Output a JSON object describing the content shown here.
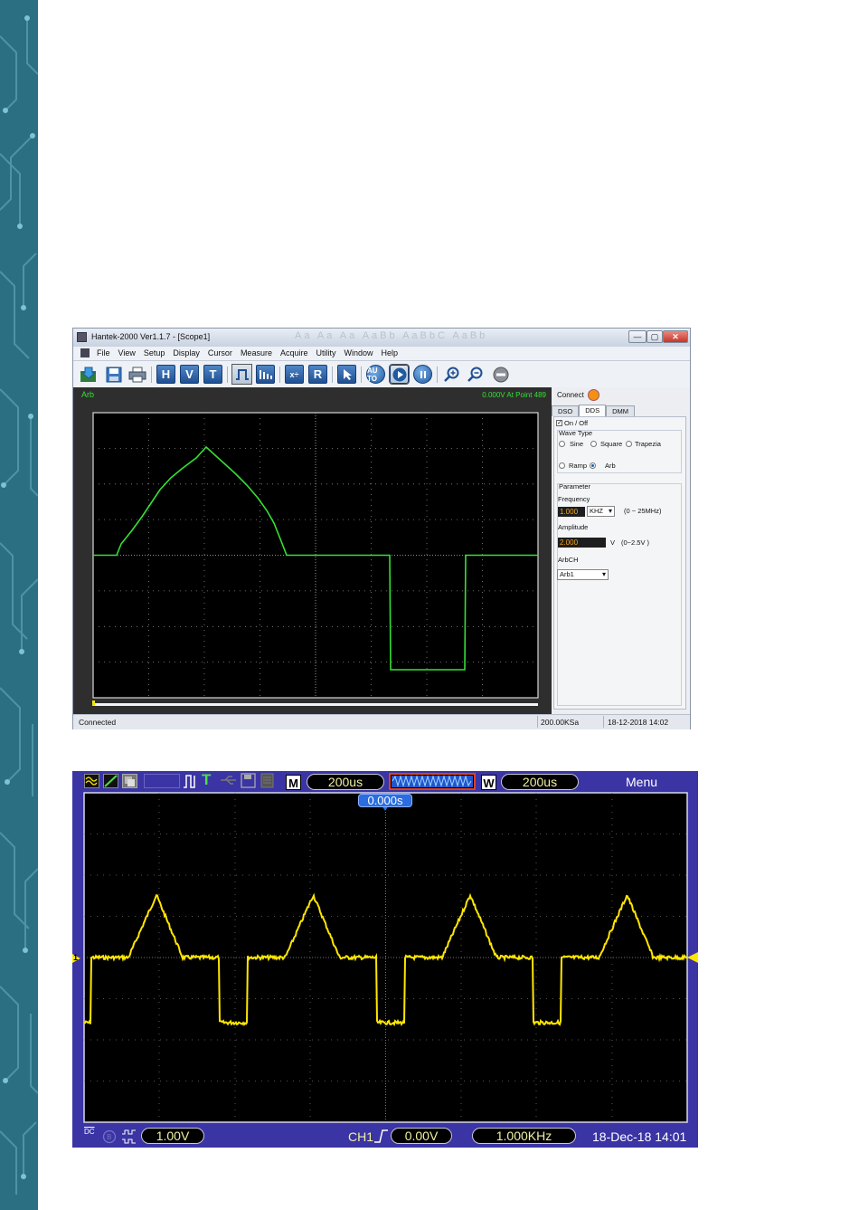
{
  "hantek": {
    "title": "Hantek-2000 Ver1.1.7 - [Scope1]",
    "ghost_text": "Aa Aa Aa AaBb AaBbC AaBb",
    "window_buttons": {
      "minimize": "—",
      "maximize": "▢",
      "close": "✕"
    },
    "mdi_buttons": {
      "minimize": "_",
      "restore": "▫",
      "close": "x"
    },
    "menu": [
      "File",
      "View",
      "Setup",
      "Display",
      "Cursor",
      "Measure",
      "Acquire",
      "Utility",
      "Window",
      "Help"
    ],
    "toolbar": {
      "h_label": "H",
      "v_label": "V",
      "t_label": "T",
      "r_label": "R",
      "auto_label": "AU TO"
    },
    "screen": {
      "label": "Arb",
      "point_info": "0.000V At Point 489"
    },
    "panel": {
      "connect_label": "Connect",
      "tabs": [
        "DSO",
        "DDS",
        "DMM"
      ],
      "active_tab": "DDS",
      "on_off_label": "On / Off",
      "on_off_checked": "✓",
      "wave_type_label": "Wave Type",
      "wave_types": [
        "Sine",
        "Square",
        "Trapezia",
        "Ramp",
        "Arb"
      ],
      "selected_wave": "Arb",
      "parameter_label": "Parameter",
      "frequency_label": "Frequency",
      "frequency_value": "1.000",
      "frequency_unit": "KHZ",
      "frequency_range": "(0 ~ 25MHz)",
      "amplitude_label": "Amplitude",
      "amplitude_value": "2.000",
      "amplitude_unit": "V",
      "amplitude_range": "(0~2.5V )",
      "arbch_label": "ArbCH",
      "arbch_value": "Arb1"
    },
    "status": {
      "left": "Connected",
      "sample_rate": "200.00KSa",
      "datetime": "18-12-2018  14:02"
    },
    "colors": {
      "trace": "#35e035",
      "led": "#f39117"
    }
  },
  "scope": {
    "top": {
      "timebase_label": "M",
      "timebase": "200us",
      "window_label": "W",
      "window_timebase": "200us",
      "menu_label": "Menu",
      "trigger_position": "0.000s"
    },
    "channel_marker": "1",
    "bottom": {
      "coupling": "DC",
      "volts_div": "1.00V",
      "trigger_channel": "CH1",
      "trigger_slope_icon": "rising-edge-icon",
      "trigger_level": "0.00V",
      "frequency": "1.000KHz",
      "datetime": "18-Dec-18 14:01"
    },
    "colors": {
      "trace": "#ffe600",
      "background": "#3a34a4"
    }
  }
}
